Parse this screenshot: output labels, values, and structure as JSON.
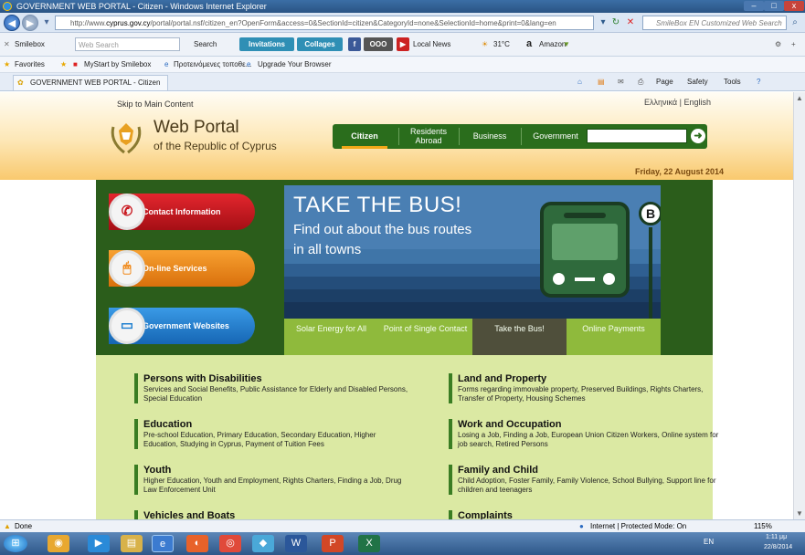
{
  "window": {
    "title": "GOVERNMENT WEB PORTAL - Citizen - Windows Internet Explorer"
  },
  "address": {
    "url_prefix": "http://www.",
    "url_domain": "cyprus.gov.cy",
    "url_rest": "/portal/portal.nsf/citizen_en?OpenForm&access=0&SectionId=citizen&CategoryId=none&SelectionId=home&print=0&lang=en",
    "search_placeholder": "SmileBox EN Customized Web Search"
  },
  "toolbar": {
    "smilebox": "Smilebox",
    "websearch": "Web Search",
    "search": "Search",
    "invitations": "Invitations",
    "collages": "Collages",
    "localnews": "Local News",
    "weather": "31°C",
    "amazon": "Amazon"
  },
  "favorites": {
    "label": "Favorites",
    "items": [
      "MyStart by Smilebox",
      "Προτεινόμενες τοποθε...",
      "Upgrade Your Browser"
    ]
  },
  "tab": {
    "label": "GOVERNMENT WEB PORTAL - Citizen"
  },
  "command": {
    "page": "Page",
    "safety": "Safety",
    "tools": "Tools"
  },
  "page": {
    "skip": "Skip to Main Content",
    "lang": "Ελληνικά | English",
    "logo_title": "Web Portal",
    "logo_sub": "of the Republic of Cyprus",
    "nav": [
      "Citizen",
      "Residents Abroad",
      "Business",
      "Government"
    ],
    "date": "Friday, 22 August 2014",
    "side_buttons": [
      "Contact Information",
      "On-line Services",
      "Government Websites"
    ],
    "banner": {
      "title": "TAKE THE BUS!",
      "line1": "Find out about the bus routes",
      "line2": "in all towns",
      "stop": "B"
    },
    "hero_tabs": [
      "Solar Energy for All",
      "Point of Single Contact",
      "Take the Bus!",
      "Online Payments"
    ],
    "categories": [
      {
        "title": "Persons with Disabilities",
        "desc": "Services and Social Benefits, Public Assistance for Elderly and Disabled Persons, Special Education"
      },
      {
        "title": "Land and Property",
        "desc": "Forms regarding immovable property, Preserved Buildings, Rights Charters, Transfer of Property, Housing Schemes"
      },
      {
        "title": "Education",
        "desc": "Pre-school Education, Primary Education, Secondary Education, Higher Education, Studying in Cyprus, Payment of Tuition Fees"
      },
      {
        "title": "Work and Occupation",
        "desc": "Losing a Job, Finding a Job, European Union Citizen Workers, Online system for job search, Retired Persons"
      },
      {
        "title": "Youth",
        "desc": "Higher Education, Youth and Employment, Rights Charters, Finding a Job, Drug Law Enforcement Unit"
      },
      {
        "title": "Family and Child",
        "desc": "Child Adoption, Foster Family, Family Violence, School Bullying, Support line for children and teenagers"
      },
      {
        "title": "Vehicles and Boats",
        "desc": ""
      },
      {
        "title": "Complaints",
        "desc": ""
      }
    ]
  },
  "status": {
    "left": "Done",
    "zone": "Internet | Protected Mode: On",
    "zoom": "115%"
  },
  "taskbar": {
    "lang": "EN",
    "time": "1:11 μμ",
    "date": "22/8/2014"
  },
  "colors": {
    "nav_green": "#2a6d1c",
    "contact_red": "#c8161d",
    "online_orange": "#f08a1c",
    "gov_blue": "#1f7fd0",
    "category_bg": "#dbe9a3"
  }
}
